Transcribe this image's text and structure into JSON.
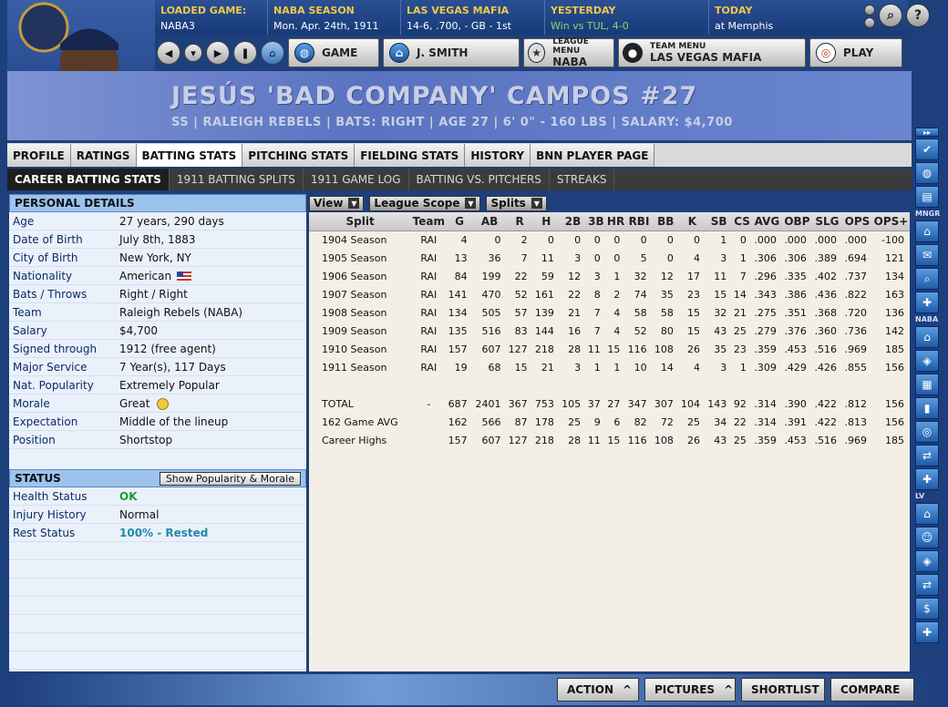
{
  "topbar": [
    {
      "head": "LOADED GAME:",
      "value": "NABA3"
    },
    {
      "head": "NABA SEASON",
      "value": "Mon. Apr. 24th, 1911"
    },
    {
      "head": "LAS VEGAS  MAFIA",
      "value": "14-6, .700, - GB - 1st"
    },
    {
      "head": "YESTERDAY",
      "value": "Win vs TUL, 4-0"
    },
    {
      "head": "TODAY",
      "value": "at Memphis"
    }
  ],
  "nav": {
    "game": "GAME",
    "manager": "J. SMITH",
    "league_menu": "LEAGUE MENU",
    "league": "NABA",
    "team_menu": "TEAM MENU",
    "team": "LAS VEGAS  MAFIA",
    "play": "PLAY"
  },
  "player": {
    "name": "JESÚS 'BAD COMPANY' CAMPOS  #27",
    "info": "SS | RALEIGH  REBELS | BATS: RIGHT | AGE 27 | 6' 0\" - 160 LBS | SALARY: $4,700"
  },
  "tabs": [
    "PROFILE",
    "RATINGS",
    "BATTING STATS",
    "PITCHING STATS",
    "FIELDING STATS",
    "HISTORY",
    "BNN PLAYER PAGE"
  ],
  "subtabs": [
    "CAREER BATTING STATS",
    "1911 BATTING SPLITS",
    "1911 GAME LOG",
    "BATTING VS. PITCHERS",
    "STREAKS"
  ],
  "personal": {
    "title": "PERSONAL DETAILS",
    "rows": [
      [
        "Age",
        "27 years, 290 days"
      ],
      [
        "Date of Birth",
        "July 8th, 1883"
      ],
      [
        "City of Birth",
        "New York, NY"
      ],
      [
        "Nationality",
        "American"
      ],
      [
        "Bats / Throws",
        "Right / Right"
      ],
      [
        "Team",
        "Raleigh  Rebels (NABA)"
      ],
      [
        "Salary",
        "$4,700"
      ],
      [
        "Signed through",
        "1912 (free agent)"
      ],
      [
        "Major Service",
        "7 Year(s), 117 Days"
      ],
      [
        "Nat. Popularity",
        "Extremely Popular"
      ],
      [
        "Morale",
        "Great"
      ],
      [
        "Expectation",
        "Middle of the lineup"
      ],
      [
        "Position",
        "Shortstop"
      ]
    ]
  },
  "status": {
    "title": "STATUS",
    "button": "Show Popularity & Morale",
    "rows": [
      [
        "Health Status",
        "OK"
      ],
      [
        "Injury History",
        "Normal"
      ],
      [
        "Rest Status",
        "100% - Rested"
      ]
    ]
  },
  "filters": {
    "view": "View",
    "scope": "League Scope",
    "splits": "Splits"
  },
  "table": {
    "headers": [
      "Split",
      "Team",
      "G",
      "AB",
      "R",
      "H",
      "2B",
      "3B",
      "HR",
      "RBI",
      "BB",
      "K",
      "SB",
      "CS",
      "AVG",
      "OBP",
      "SLG",
      "OPS",
      "OPS+"
    ],
    "rows": [
      [
        "1904 Season",
        "RAI",
        "4",
        "0",
        "2",
        "0",
        "0",
        "0",
        "0",
        "0",
        "0",
        "0",
        "1",
        "0",
        ".000",
        ".000",
        ".000",
        ".000",
        "-100"
      ],
      [
        "1905 Season",
        "RAI",
        "13",
        "36",
        "7",
        "11",
        "3",
        "0",
        "0",
        "5",
        "0",
        "4",
        "3",
        "1",
        ".306",
        ".306",
        ".389",
        ".694",
        "121"
      ],
      [
        "1906 Season",
        "RAI",
        "84",
        "199",
        "22",
        "59",
        "12",
        "3",
        "1",
        "32",
        "12",
        "17",
        "11",
        "7",
        ".296",
        ".335",
        ".402",
        ".737",
        "134"
      ],
      [
        "1907 Season",
        "RAI",
        "141",
        "470",
        "52",
        "161",
        "22",
        "8",
        "2",
        "74",
        "35",
        "23",
        "15",
        "14",
        ".343",
        ".386",
        ".436",
        ".822",
        "163"
      ],
      [
        "1908 Season",
        "RAI",
        "134",
        "505",
        "57",
        "139",
        "21",
        "7",
        "4",
        "58",
        "58",
        "15",
        "32",
        "21",
        ".275",
        ".351",
        ".368",
        ".720",
        "136"
      ],
      [
        "1909 Season",
        "RAI",
        "135",
        "516",
        "83",
        "144",
        "16",
        "7",
        "4",
        "52",
        "80",
        "15",
        "43",
        "25",
        ".279",
        ".376",
        ".360",
        ".736",
        "142"
      ],
      [
        "1910 Season",
        "RAI",
        "157",
        "607",
        "127",
        "218",
        "28",
        "11",
        "15",
        "116",
        "108",
        "26",
        "35",
        "23",
        ".359",
        ".453",
        ".516",
        ".969",
        "185"
      ],
      [
        "1911 Season",
        "RAI",
        "19",
        "68",
        "15",
        "21",
        "3",
        "1",
        "1",
        "10",
        "14",
        "4",
        "3",
        "1",
        ".309",
        ".429",
        ".426",
        ".855",
        "156"
      ]
    ],
    "totals": [
      [
        "TOTAL",
        "-",
        "687",
        "2401",
        "367",
        "753",
        "105",
        "37",
        "27",
        "347",
        "307",
        "104",
        "143",
        "92",
        ".314",
        ".390",
        ".422",
        ".812",
        "156"
      ],
      [
        "162 Game AVG",
        "",
        "162",
        "566",
        "87",
        "178",
        "25",
        "9",
        "6",
        "82",
        "72",
        "25",
        "34",
        "22",
        ".314",
        ".391",
        ".422",
        ".813",
        "156"
      ],
      [
        "Career Highs",
        "",
        "157",
        "607",
        "127",
        "218",
        "28",
        "11",
        "15",
        "116",
        "108",
        "26",
        "43",
        "25",
        ".359",
        ".453",
        ".516",
        ".969",
        "185"
      ]
    ]
  },
  "strip": {
    "mngr": "MNGR",
    "naba": "NABA",
    "lv": "LV"
  },
  "bottom": [
    "ACTION",
    "PICTURES",
    "SHORTLIST",
    "COMPARE"
  ]
}
